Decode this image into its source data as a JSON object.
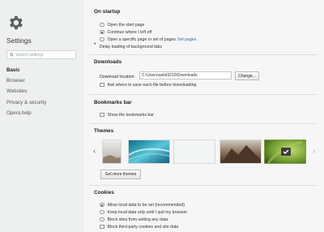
{
  "sidebar": {
    "title": "Settings",
    "search_placeholder": "Search settings",
    "items": [
      {
        "label": "Basic"
      },
      {
        "label": "Browser"
      },
      {
        "label": "Websites"
      },
      {
        "label": "Privacy & security"
      },
      {
        "label": "Opera help"
      }
    ],
    "active_index": 0
  },
  "startup": {
    "title": "On startup",
    "options": [
      {
        "label": "Open the start page",
        "selected": false
      },
      {
        "label": "Continue where I left off",
        "selected": true
      },
      {
        "label": "Open a specific page or set of pages",
        "selected": false
      }
    ],
    "set_pages_link": "Set pages",
    "delay_label": "Delay loading of background tabs"
  },
  "downloads": {
    "title": "Downloads",
    "location_label": "Download location:",
    "location_value": "C:\\Users\\ankit3210\\Downloads",
    "change_button": "Change...",
    "ask_label": "Ask where to save each file before downloading"
  },
  "bookmarks": {
    "title": "Bookmarks bar",
    "show_label": "Show the bookmarks bar"
  },
  "themes": {
    "title": "Themes",
    "get_more_button": "Get more themes",
    "selected_index": 4
  },
  "cookies": {
    "title": "Cookies",
    "options": [
      {
        "label": "Allow local data to be set (recommended)",
        "selected": true
      },
      {
        "label": "Keep local data only until I quit my browser",
        "selected": false
      },
      {
        "label": "Block sites from setting any data",
        "selected": false
      }
    ],
    "block_third_party_label": "Block third-party cookies and site data"
  },
  "colors": {
    "link": "#2d6ab3",
    "sidebar_bg": "#edf0ee",
    "content_bg": "#f5f6f5"
  },
  "icons": {
    "app": "gear-icon",
    "search": "search-icon",
    "prev": "chevron-left-icon",
    "next": "chevron-right-icon",
    "selected_theme": "checkmark-icon"
  }
}
